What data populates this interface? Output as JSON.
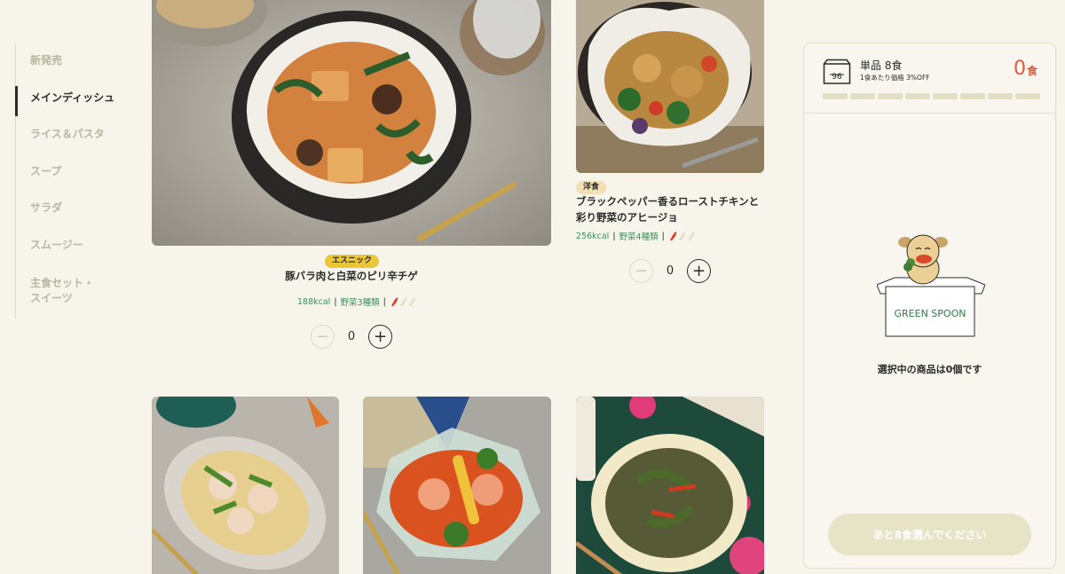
{
  "sidebar": {
    "items": [
      {
        "label": "新発売"
      },
      {
        "label": "メインディッシュ"
      },
      {
        "label": "ライス＆パスタ"
      },
      {
        "label": "スープ"
      },
      {
        "label": "サラダ"
      },
      {
        "label": "スムージー"
      },
      {
        "label": "主食セット・\nスイーツ"
      }
    ]
  },
  "products": [
    {
      "tag": "エスニック",
      "title": "豚バラ肉と白菜のピリ辛チゲ",
      "kcal": "188kcal",
      "veg": "野菜3種類",
      "spice_level": 1,
      "qty": "0"
    },
    {
      "tag": "洋食",
      "title": "ブラックペッパー香るローストチキンと彩り野菜のアヒージョ",
      "kcal": "256kcal",
      "veg": "野菜4種類",
      "spice_level": 1,
      "qty": "0"
    }
  ],
  "cart": {
    "plan": "単品 8食",
    "unit": "1食あたり価格 3%OFF",
    "count": "0",
    "count_suffix": "食",
    "slots_total": 8,
    "brand": "GREEN SPOON",
    "empty_message": "選択中の商品は0個です",
    "cta": "あと8食選んでください"
  },
  "colors": {
    "accent": "#e15a3c",
    "green": "#3f8e5c",
    "bg": "#f6f4eb",
    "tag_ethnic": "#e9c736",
    "tag_western": "#f1dfb6"
  },
  "icons": {
    "minus": "minus-icon",
    "plus": "plus-icon",
    "box": "box-icon",
    "chili": "chili-icon"
  }
}
